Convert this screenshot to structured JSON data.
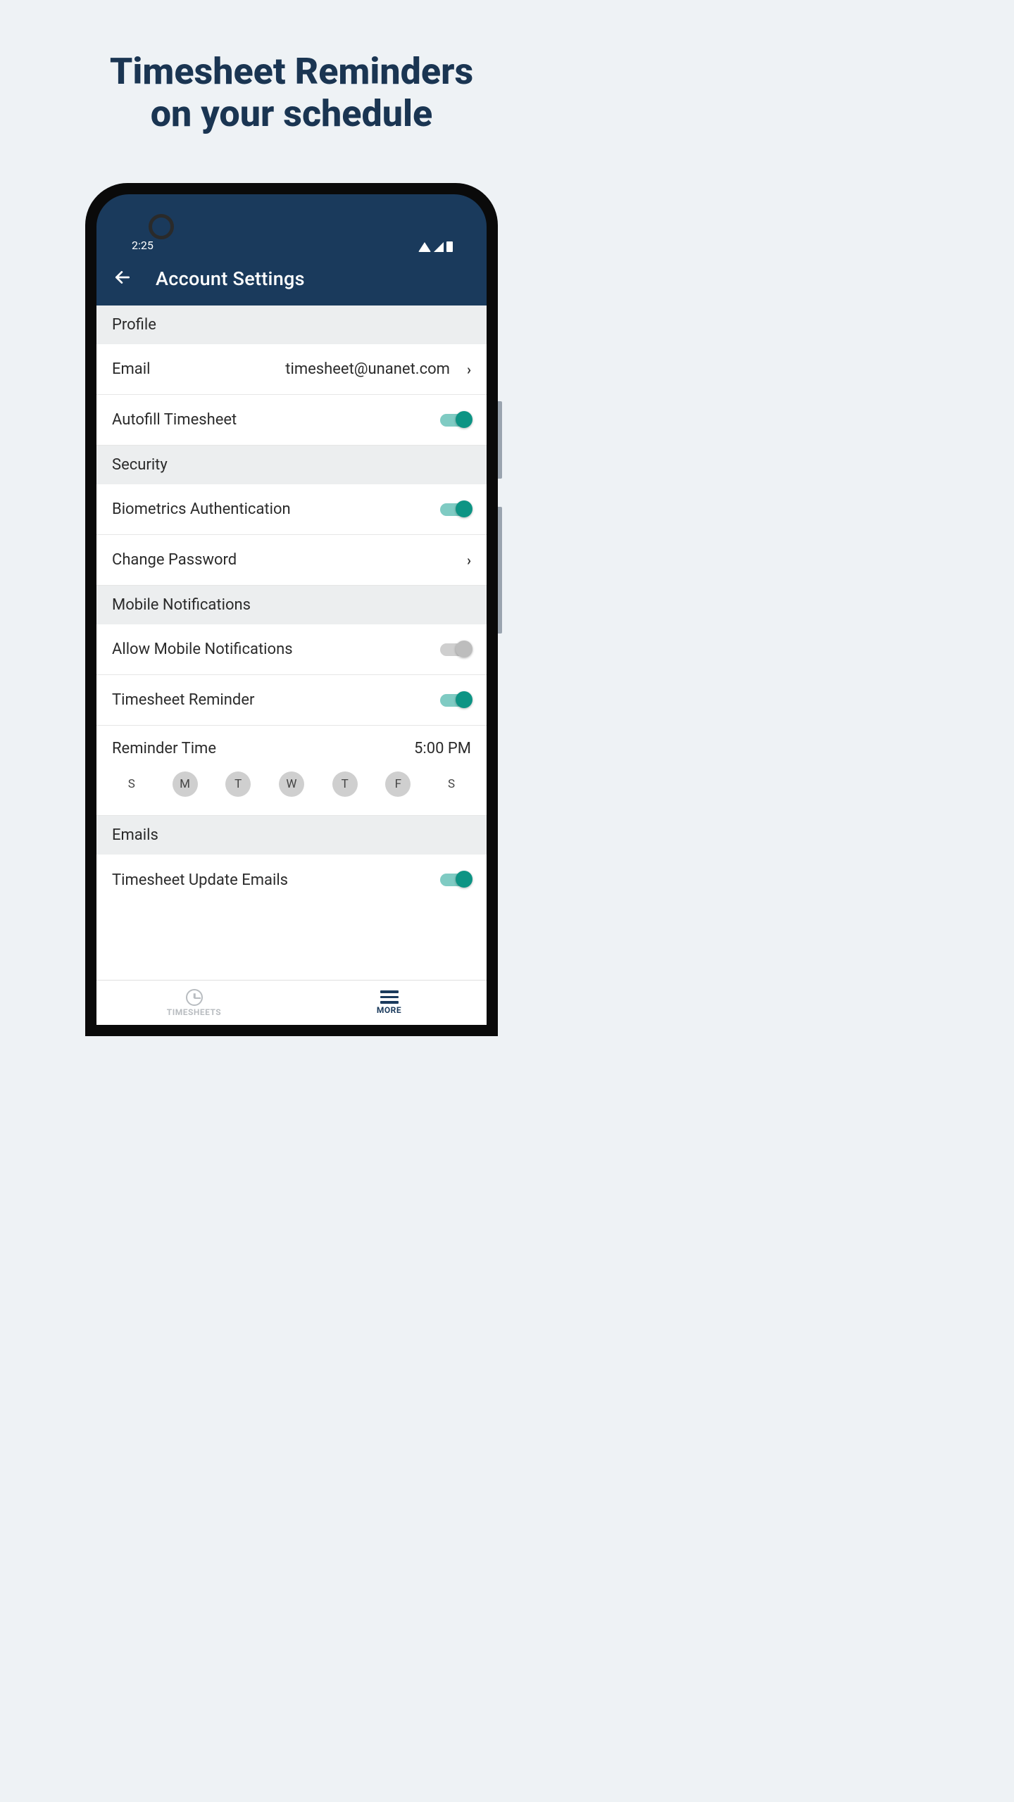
{
  "promo": {
    "line1": "Timesheet Reminders",
    "line2": "on your schedule"
  },
  "status": {
    "time": "2:25"
  },
  "header": {
    "title": "Account Settings"
  },
  "sections": {
    "profile": {
      "title": "Profile",
      "email": {
        "label": "Email",
        "value": "timesheet@unanet.com"
      },
      "autofill": {
        "label": "Autofill Timesheet",
        "on": true
      }
    },
    "security": {
      "title": "Security",
      "biometrics": {
        "label": "Biometrics Authentication",
        "on": true
      },
      "change_pw": {
        "label": "Change Password"
      }
    },
    "notifications": {
      "title": "Mobile Notifications",
      "allow": {
        "label": "Allow Mobile Notifications",
        "on": false
      },
      "reminder": {
        "label": "Timesheet Reminder",
        "on": true
      },
      "reminder_time": {
        "label": "Reminder Time",
        "value": "5:00 PM"
      },
      "days": [
        {
          "label": "S",
          "selected": false
        },
        {
          "label": "M",
          "selected": true
        },
        {
          "label": "T",
          "selected": true
        },
        {
          "label": "W",
          "selected": true
        },
        {
          "label": "T",
          "selected": true
        },
        {
          "label": "F",
          "selected": true
        },
        {
          "label": "S",
          "selected": false
        }
      ]
    },
    "emails": {
      "title": "Emails",
      "update_emails": {
        "label": "Timesheet Update Emails",
        "on": true
      }
    }
  },
  "nav": {
    "timesheets": {
      "label": "TIMESHEETS"
    },
    "more": {
      "label": "MORE"
    }
  }
}
